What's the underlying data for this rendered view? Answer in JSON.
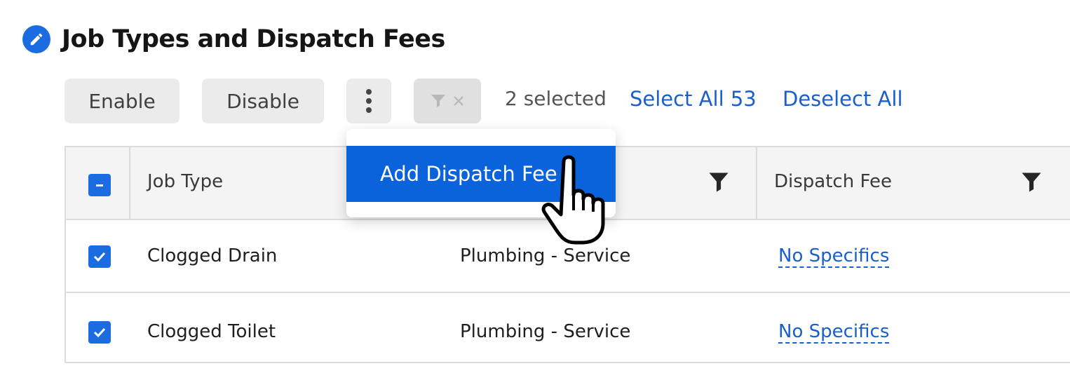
{
  "header": {
    "title": "Job Types and Dispatch Fees",
    "icon": "pencil-icon",
    "accent": "#1a6ce0"
  },
  "toolbar": {
    "enable_label": "Enable",
    "disable_label": "Disable",
    "more_icon": "kebab-icon",
    "filter_clear_icon": "filter-clear-icon",
    "selected_count": "2 selected",
    "select_all_label": "Select All 53",
    "deselect_all_label": "Deselect All"
  },
  "dropdown": {
    "items": [
      {
        "label": "Add Dispatch Fee"
      }
    ],
    "highlight_color": "#0a63db"
  },
  "table": {
    "columns": [
      {
        "label": "Job Type"
      },
      {
        "label": ""
      },
      {
        "label": "Dispatch Fee"
      }
    ],
    "rows": [
      {
        "checked": true,
        "job_type": "Clogged Drain",
        "category": "Plumbing - Service",
        "dispatch_fee": "No Specifics"
      },
      {
        "checked": true,
        "job_type": "Clogged Toilet",
        "category": "Plumbing - Service",
        "dispatch_fee": "No Specifics"
      }
    ]
  }
}
